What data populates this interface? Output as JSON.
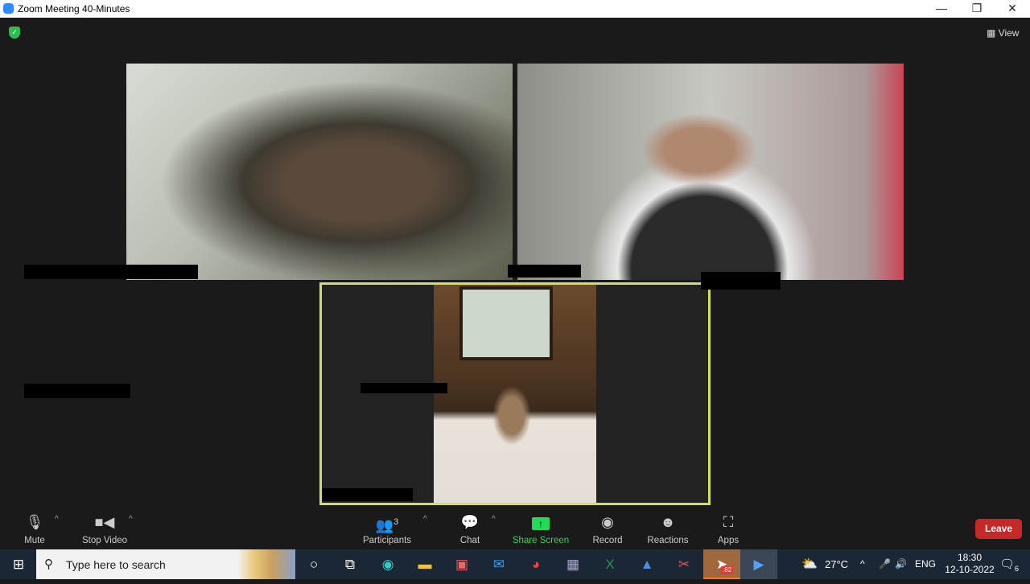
{
  "window": {
    "title": "Zoom Meeting 40-Minutes",
    "minimize": "—",
    "restore": "❐",
    "close": "✕"
  },
  "header": {
    "view_label": "View",
    "security_icon": "shield-check-icon"
  },
  "participants_grid": {
    "active_speaker_border": "#d4e157",
    "tiles": [
      {
        "name_redacted": true
      },
      {
        "name_redacted": true
      },
      {
        "name_redacted": true
      }
    ]
  },
  "toolbar": {
    "mute": "Mute",
    "stop_video": "Stop Video",
    "participants": "Participants",
    "participants_count": "3",
    "chat": "Chat",
    "share_screen": "Share Screen",
    "record": "Record",
    "reactions": "Reactions",
    "apps": "Apps",
    "leave": "Leave",
    "share_color": "#23d959",
    "leave_color": "#c62828"
  },
  "taskbar": {
    "search_placeholder": "Type here to search",
    "telegram_badge": ".82",
    "weather": "27°C",
    "language": "ENG",
    "time": "18:30",
    "date": "12-10-2022",
    "notifications": "6"
  }
}
